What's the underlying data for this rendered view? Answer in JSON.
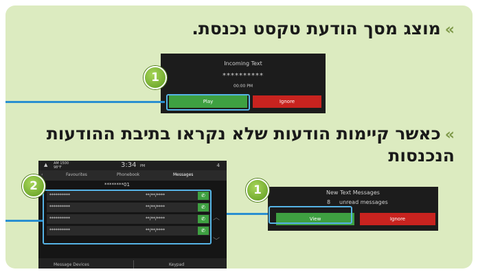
{
  "colors": {
    "panel": "#dcebc0",
    "green": "#3ea041",
    "red": "#c8231f",
    "highlight": "#56b4e6",
    "badge": "#7cbc33"
  },
  "heading1": "מוצג מסך הודעת טקסט נכנסת.",
  "heading2": "כאשר קיימות הודעות שלא נקראו בתיבת ההודעות הנכנסות",
  "chevron": "»",
  "incoming": {
    "title": "Incoming Text",
    "number": "**********",
    "time": "00:00 PM",
    "play": "Play",
    "ignore": "Ignore"
  },
  "newmsg": {
    "title": "New Text Messages",
    "count": "8",
    "label": "unread messages",
    "view": "View",
    "ignore": "Ignore"
  },
  "phone": {
    "status": {
      "label": "AM 1500",
      "sub": "98°F",
      "time": "3:34",
      "ampm": "PM",
      "right": "4"
    },
    "tabs": [
      "Favourites",
      "Phonebook",
      "Messages"
    ],
    "number": "********01",
    "rows": [
      {
        "name": "**********",
        "date": "**/**/****"
      },
      {
        "name": "**********",
        "date": "**/**/****"
      },
      {
        "name": "**********",
        "date": "**/**/****"
      },
      {
        "name": "**********",
        "date": "**/**/****"
      }
    ],
    "footer": {
      "left": "Message Devices",
      "right": "Keypad"
    }
  },
  "badges": [
    "1",
    "1",
    "2"
  ],
  "icons": {
    "chevron": "chevron-icon",
    "phone": "phone-icon"
  }
}
